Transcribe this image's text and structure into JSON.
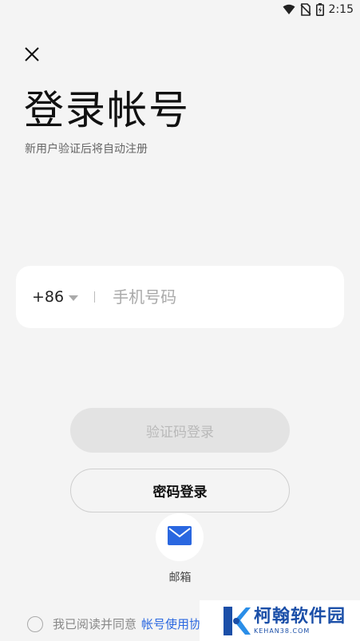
{
  "status_bar": {
    "time": "2:15",
    "icons": [
      "wifi-icon",
      "no-sim-icon",
      "battery-icon"
    ]
  },
  "header": {
    "close_icon": "close-icon",
    "title": "登录帐号",
    "subtitle": "新用户验证后将自动注册"
  },
  "phone": {
    "country_code": "+86",
    "placeholder": "手机号码",
    "value": ""
  },
  "actions": {
    "code_login_label": "验证码登录",
    "password_login_label": "密码登录",
    "email_label": "邮箱"
  },
  "agreement": {
    "prefix": "我已阅读并同意",
    "link": "帐号使用协"
  },
  "watermark": {
    "name": "柯翰软件园",
    "url": "KEHAN38.COM"
  },
  "colors": {
    "background": "#f4f4f4",
    "accent": "#2a67e0",
    "disabled_button": "#e3e3e3",
    "watermark": "#1b4fa8"
  }
}
